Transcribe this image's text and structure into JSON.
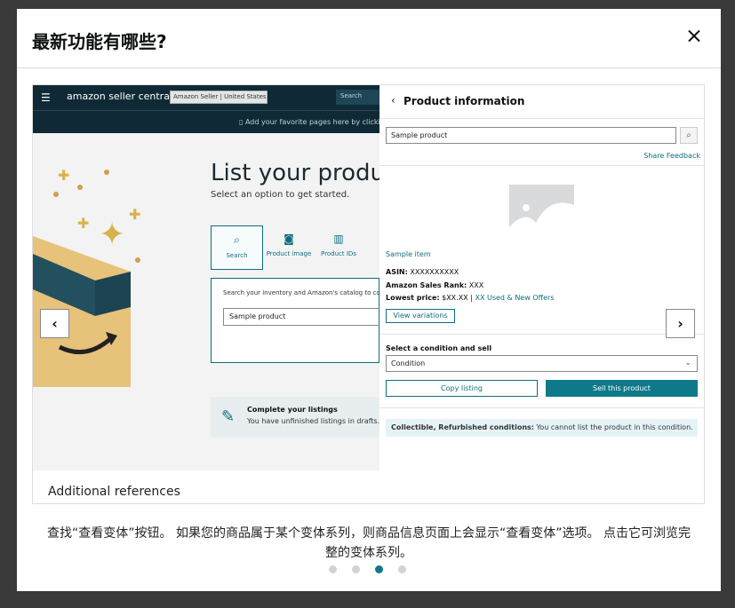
{
  "modal": {
    "title": "最新功能有哪些?",
    "caption": "查找“查看变体”按钮。 如果您的商品属于某个变体系列，则商品信息页面上会显示“查看变体”选项。 点击它可浏览完整的变体系列。",
    "pagination": {
      "total": 4,
      "active_index": 2
    }
  },
  "screenshot": {
    "topbar": {
      "brand": "amazon",
      "brand_sub": "seller central",
      "seller_box": "Amazon Seller | United States",
      "search_placeholder": "Search",
      "favorites_text": "Add your favorite pages here by clicking t"
    },
    "background": {
      "list_title": "List your product",
      "list_subtitle": "Select an option to get started.",
      "options": [
        {
          "label": "Search",
          "icon": "search-icon"
        },
        {
          "label": "Product image",
          "icon": "camera-icon"
        },
        {
          "label": "Product IDs",
          "icon": "barcode-icon"
        }
      ],
      "search_panel_text": "Search your inventory and Amazon's catalog to co",
      "search_value": "Sample product",
      "complete_title": "Complete your listings",
      "complete_text": "You have unfinished listings in drafts. V",
      "additional_references": "Additional references"
    },
    "panel": {
      "title": "Product information",
      "search_value": "Sample product",
      "share_feedback": "Share Feedback",
      "item_name": "Sample item",
      "asin_label": "ASIN:",
      "asin_value": "XXXXXXXXXX",
      "rank_label": "Amazon Sales Rank:",
      "rank_value": "XXX",
      "price_label": "Lowest price:",
      "price_value": "$XX.XX",
      "price_sep": "|",
      "offers_link": "XX Used & New Offers",
      "view_variations": "View variations",
      "select_label": "Select a condition and sell",
      "condition_value": "Condition",
      "copy_listing": "Copy listing",
      "sell_this": "Sell this product",
      "notice_bold": "Collectible, Refurbished conditions:",
      "notice_text": "You cannot list the product in this condition."
    }
  },
  "colors": {
    "accent": "#0e7a89",
    "topbar": "#0f2a36"
  }
}
